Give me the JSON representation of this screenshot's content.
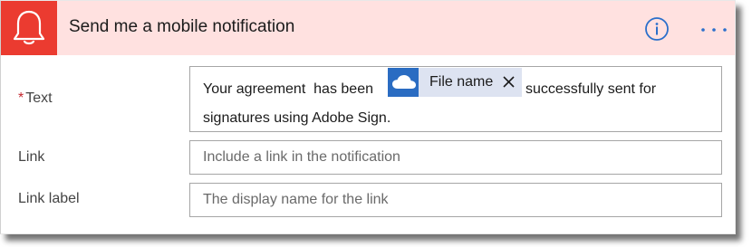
{
  "header": {
    "title": "Send me a mobile notification",
    "accent_color": "#eb3b30",
    "background_color": "#ffe1e0",
    "icon": "bell-icon",
    "info_icon": "info-icon",
    "more_icon": "more-options-icon"
  },
  "fields": {
    "text": {
      "required_mark": "*",
      "label": "Text",
      "value_before_token": "Your agreement  has been",
      "token": {
        "label": "File name",
        "icon": "onedrive-cloud-icon",
        "remove_glyph": "✕"
      },
      "value_after_token": "successfully sent for",
      "value_line_2": "signatures using Adobe Sign."
    },
    "link": {
      "label": "Link",
      "placeholder": "Include a link in the notification"
    },
    "link_label": {
      "label": "Link label",
      "placeholder": "The display name for the link"
    }
  }
}
